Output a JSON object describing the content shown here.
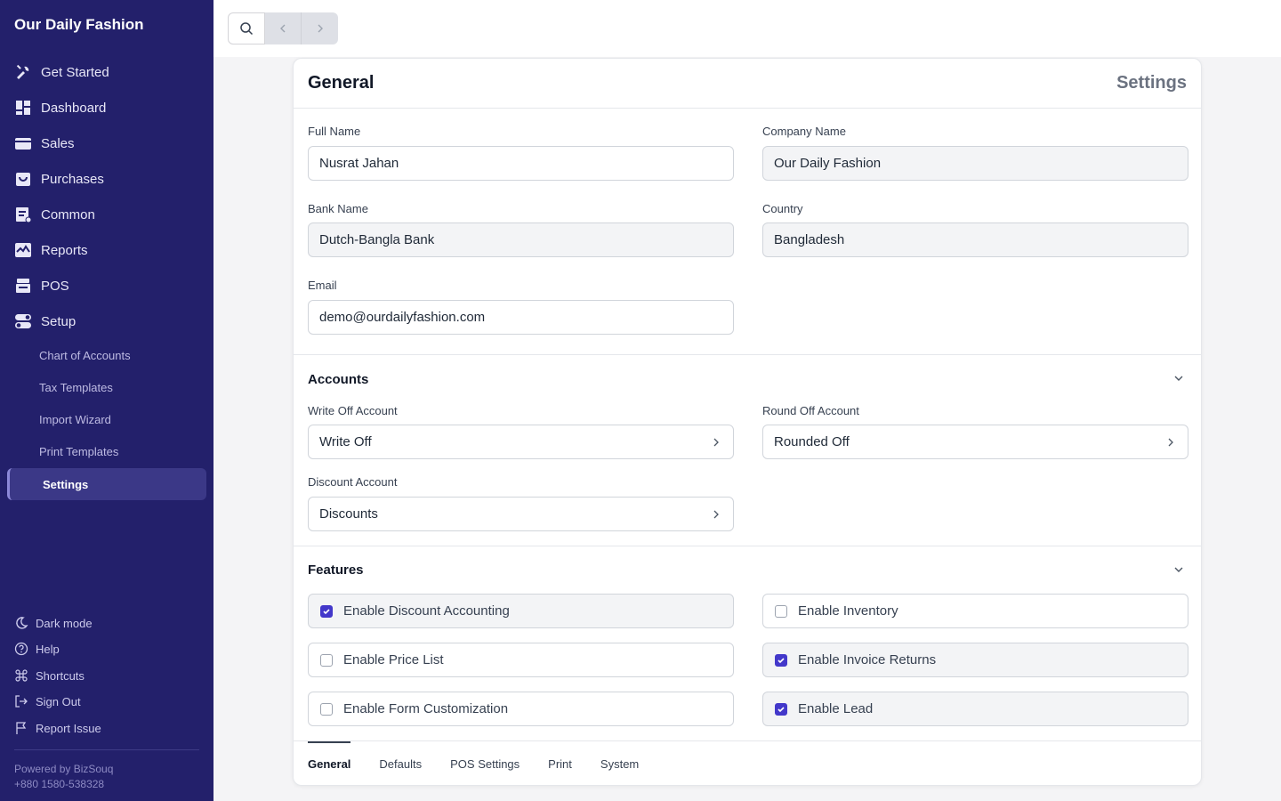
{
  "sidebar": {
    "brand": "Our Daily Fashion",
    "nav": [
      {
        "label": "Get Started",
        "icon": "tools-icon"
      },
      {
        "label": "Dashboard",
        "icon": "dashboard-icon"
      },
      {
        "label": "Sales",
        "icon": "sales-icon"
      },
      {
        "label": "Purchases",
        "icon": "purchases-icon"
      },
      {
        "label": "Common",
        "icon": "common-icon"
      },
      {
        "label": "Reports",
        "icon": "reports-icon"
      },
      {
        "label": "POS",
        "icon": "pos-icon"
      },
      {
        "label": "Setup",
        "icon": "setup-icon"
      }
    ],
    "setup_items": [
      "Chart of Accounts",
      "Tax Templates",
      "Import Wizard",
      "Print Templates",
      "Settings"
    ],
    "footer": [
      {
        "label": "Dark mode",
        "icon": "moon-icon"
      },
      {
        "label": "Help",
        "icon": "help-icon"
      },
      {
        "label": "Shortcuts",
        "icon": "command-icon"
      },
      {
        "label": "Sign Out",
        "icon": "sign-out-icon"
      },
      {
        "label": "Report Issue",
        "icon": "flag-icon"
      }
    ],
    "powered_by": "Powered by BizSouq",
    "phone": "+880 1580-538328"
  },
  "page": {
    "title": "General",
    "breadcrumb": "Settings"
  },
  "general": {
    "full_name_label": "Full Name",
    "full_name": "Nusrat Jahan",
    "company_name_label": "Company Name",
    "company_name": "Our Daily Fashion",
    "bank_name_label": "Bank Name",
    "bank_name": "Dutch-Bangla Bank",
    "country_label": "Country",
    "country": "Bangladesh",
    "email_label": "Email",
    "email": "demo@ourdailyfashion.com"
  },
  "accounts": {
    "title": "Accounts",
    "write_off_label": "Write Off Account",
    "write_off": "Write Off",
    "round_off_label": "Round Off Account",
    "round_off": "Rounded Off",
    "discount_label": "Discount Account",
    "discount": "Discounts"
  },
  "features": {
    "title": "Features",
    "items": [
      {
        "label": "Enable Discount Accounting",
        "checked": true
      },
      {
        "label": "Enable Inventory",
        "checked": false
      },
      {
        "label": "Enable Price List",
        "checked": false
      },
      {
        "label": "Enable Invoice Returns",
        "checked": true
      },
      {
        "label": "Enable Form Customization",
        "checked": false
      },
      {
        "label": "Enable Lead",
        "checked": true
      }
    ]
  },
  "tabs": [
    "General",
    "Defaults",
    "POS Settings",
    "Print",
    "System"
  ],
  "colors": {
    "sidebar": "#23206b",
    "accent": "#4338ca"
  }
}
